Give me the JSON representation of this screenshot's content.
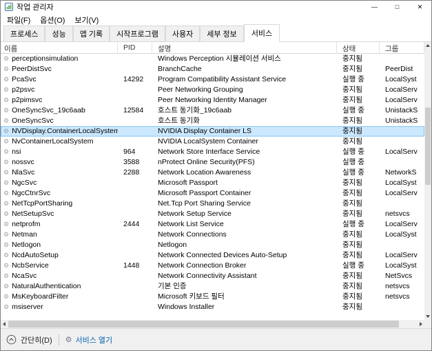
{
  "window": {
    "title": "작업 관리자",
    "controls": {
      "minimize": "—",
      "maximize": "□",
      "close": "✕"
    }
  },
  "menubar": {
    "items": [
      "파일(F)",
      "옵션(O)",
      "보기(V)"
    ]
  },
  "tabs": {
    "items": [
      "프로세스",
      "성능",
      "앱 기록",
      "시작프로그램",
      "사용자",
      "세부 정보",
      "서비스"
    ],
    "active_index": 6,
    "active_label": "서비스"
  },
  "table": {
    "columns": [
      "이름",
      "PID",
      "설명",
      "상태",
      "그룹"
    ],
    "selected_index": 7,
    "rows": [
      {
        "name": "perceptionsimulation",
        "pid": "",
        "desc": "Windows Perception 시뮬레이션 서비스",
        "status": "중지됨",
        "group": ""
      },
      {
        "name": "PeerDistSvc",
        "pid": "",
        "desc": "BranchCache",
        "status": "중지됨",
        "group": "PeerDist"
      },
      {
        "name": "PcaSvc",
        "pid": "14292",
        "desc": "Program Compatibility Assistant Service",
        "status": "실행 중",
        "group": "LocalSyst"
      },
      {
        "name": "p2psvc",
        "pid": "",
        "desc": "Peer Networking Grouping",
        "status": "중지됨",
        "group": "LocalServ"
      },
      {
        "name": "p2pimsvc",
        "pid": "",
        "desc": "Peer Networking Identity Manager",
        "status": "중지됨",
        "group": "LocalServ"
      },
      {
        "name": "OneSyncSvc_19c6aab",
        "pid": "12584",
        "desc": "호스트 동기화_19c6aab",
        "status": "실행 중",
        "group": "UnistackS"
      },
      {
        "name": "OneSyncSvc",
        "pid": "",
        "desc": "호스트 동기화",
        "status": "중지됨",
        "group": "UnistackS"
      },
      {
        "name": "NVDisplay.ContainerLocalSystem",
        "pid": "",
        "desc": "NVIDIA Display Container LS",
        "status": "중지됨",
        "group": ""
      },
      {
        "name": "NvContainerLocalSystem",
        "pid": "",
        "desc": "NVIDIA LocalSystem Container",
        "status": "중지됨",
        "group": ""
      },
      {
        "name": "nsi",
        "pid": "964",
        "desc": "Network Store Interface Service",
        "status": "실행 중",
        "group": "LocalServ"
      },
      {
        "name": "nossvc",
        "pid": "3588",
        "desc": "nProtect Online Security(PFS)",
        "status": "실행 중",
        "group": ""
      },
      {
        "name": "NlaSvc",
        "pid": "2288",
        "desc": "Network Location Awareness",
        "status": "실행 중",
        "group": "NetworkS"
      },
      {
        "name": "NgcSvc",
        "pid": "",
        "desc": "Microsoft Passport",
        "status": "중지됨",
        "group": "LocalSyst"
      },
      {
        "name": "NgcCtnrSvc",
        "pid": "",
        "desc": "Microsoft Passport Container",
        "status": "중지됨",
        "group": "LocalServ"
      },
      {
        "name": "NetTcpPortSharing",
        "pid": "",
        "desc": "Net.Tcp Port Sharing Service",
        "status": "중지됨",
        "group": ""
      },
      {
        "name": "NetSetupSvc",
        "pid": "",
        "desc": "Network Setup Service",
        "status": "중지됨",
        "group": "netsvcs"
      },
      {
        "name": "netprofm",
        "pid": "2444",
        "desc": "Network List Service",
        "status": "실행 중",
        "group": "LocalServ"
      },
      {
        "name": "Netman",
        "pid": "",
        "desc": "Network Connections",
        "status": "중지됨",
        "group": "LocalSyst"
      },
      {
        "name": "Netlogon",
        "pid": "",
        "desc": "Netlogon",
        "status": "중지됨",
        "group": ""
      },
      {
        "name": "NcdAutoSetup",
        "pid": "",
        "desc": "Network Connected Devices Auto-Setup",
        "status": "중지됨",
        "group": "LocalServ"
      },
      {
        "name": "NcbService",
        "pid": "1448",
        "desc": "Network Connection Broker",
        "status": "실행 중",
        "group": "LocalSyst"
      },
      {
        "name": "NcaSvc",
        "pid": "",
        "desc": "Network Connectivity Assistant",
        "status": "중지됨",
        "group": "NetSvcs"
      },
      {
        "name": "NaturalAuthentication",
        "pid": "",
        "desc": "기본 인증",
        "status": "중지됨",
        "group": "netsvcs"
      },
      {
        "name": "MsKeyboardFilter",
        "pid": "",
        "desc": "Microsoft 키보드 필터",
        "status": "중지됨",
        "group": "netsvcs"
      },
      {
        "name": "msiserver",
        "pid": "",
        "desc": "Windows Installer",
        "status": "중지됨",
        "group": ""
      }
    ]
  },
  "icons": {
    "service_gear": "⚙"
  },
  "footer": {
    "fewer_details": "간단히(D)",
    "open_services": "서비스 열기"
  },
  "colors": {
    "selection_bg": "#cce8ff",
    "selection_border": "#84c7f0",
    "link": "#0062b1"
  }
}
